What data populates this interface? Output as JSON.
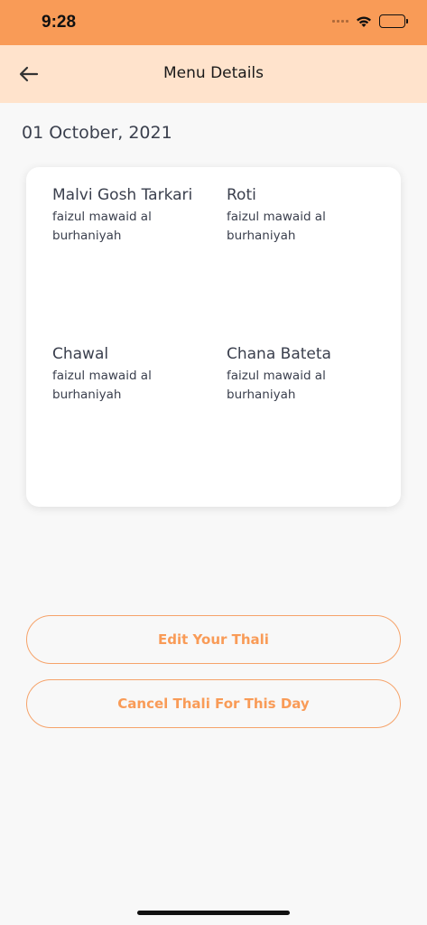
{
  "status_bar": {
    "time": "9:28"
  },
  "header": {
    "title": "Menu Details"
  },
  "date": "01 October, 2021",
  "menu_items": [
    {
      "name": "Malvi Gosh Tarkari",
      "source": "faizul mawaid al burhaniyah"
    },
    {
      "name": "Roti",
      "source": "faizul mawaid al burhaniyah"
    },
    {
      "name": "Chawal",
      "source": "faizul mawaid al burhaniyah"
    },
    {
      "name": "Chana Bateta",
      "source": "faizul mawaid al burhaniyah"
    }
  ],
  "buttons": {
    "edit_label": "Edit Your Thali",
    "cancel_label": "Cancel Thali For This Day"
  },
  "colors": {
    "accent": "#f99b57",
    "header_bg": "#ffe3cc"
  }
}
